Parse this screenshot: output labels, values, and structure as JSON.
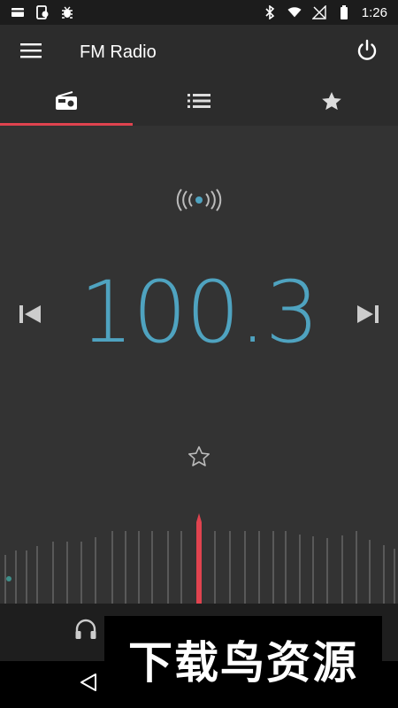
{
  "status_bar": {
    "time": "1:26",
    "left_icons": [
      "card-icon",
      "phone-sync-icon",
      "bug-icon"
    ],
    "right_icons": [
      "bluetooth-icon",
      "wifi-icon",
      "no-signal-icon",
      "battery-icon"
    ]
  },
  "app_bar": {
    "title": "FM Radio",
    "menu_icon": "hamburger-menu-icon",
    "power_icon": "power-icon"
  },
  "tabs": [
    {
      "icon": "radio-icon",
      "active": true
    },
    {
      "icon": "list-icon",
      "active": false
    },
    {
      "icon": "star-icon",
      "active": false
    }
  ],
  "tuner": {
    "frequency": "100.3",
    "signal_icon": "broadcast-signal-icon",
    "prev_icon": "skip-previous-icon",
    "next_icon": "skip-next-icon",
    "favorite_icon": "star-outline-icon"
  },
  "colors": {
    "accent": "#e0434f",
    "frequency": "#4fa3c0",
    "signal": "#4fa3c0",
    "background": "#333333",
    "app_bar": "#2c2c2c"
  },
  "bottom_bar": {
    "headset_icon": "headphones-icon"
  },
  "nav_bar": {
    "back_icon": "back-triangle-icon"
  },
  "watermark": {
    "text": "下载鸟资源"
  }
}
